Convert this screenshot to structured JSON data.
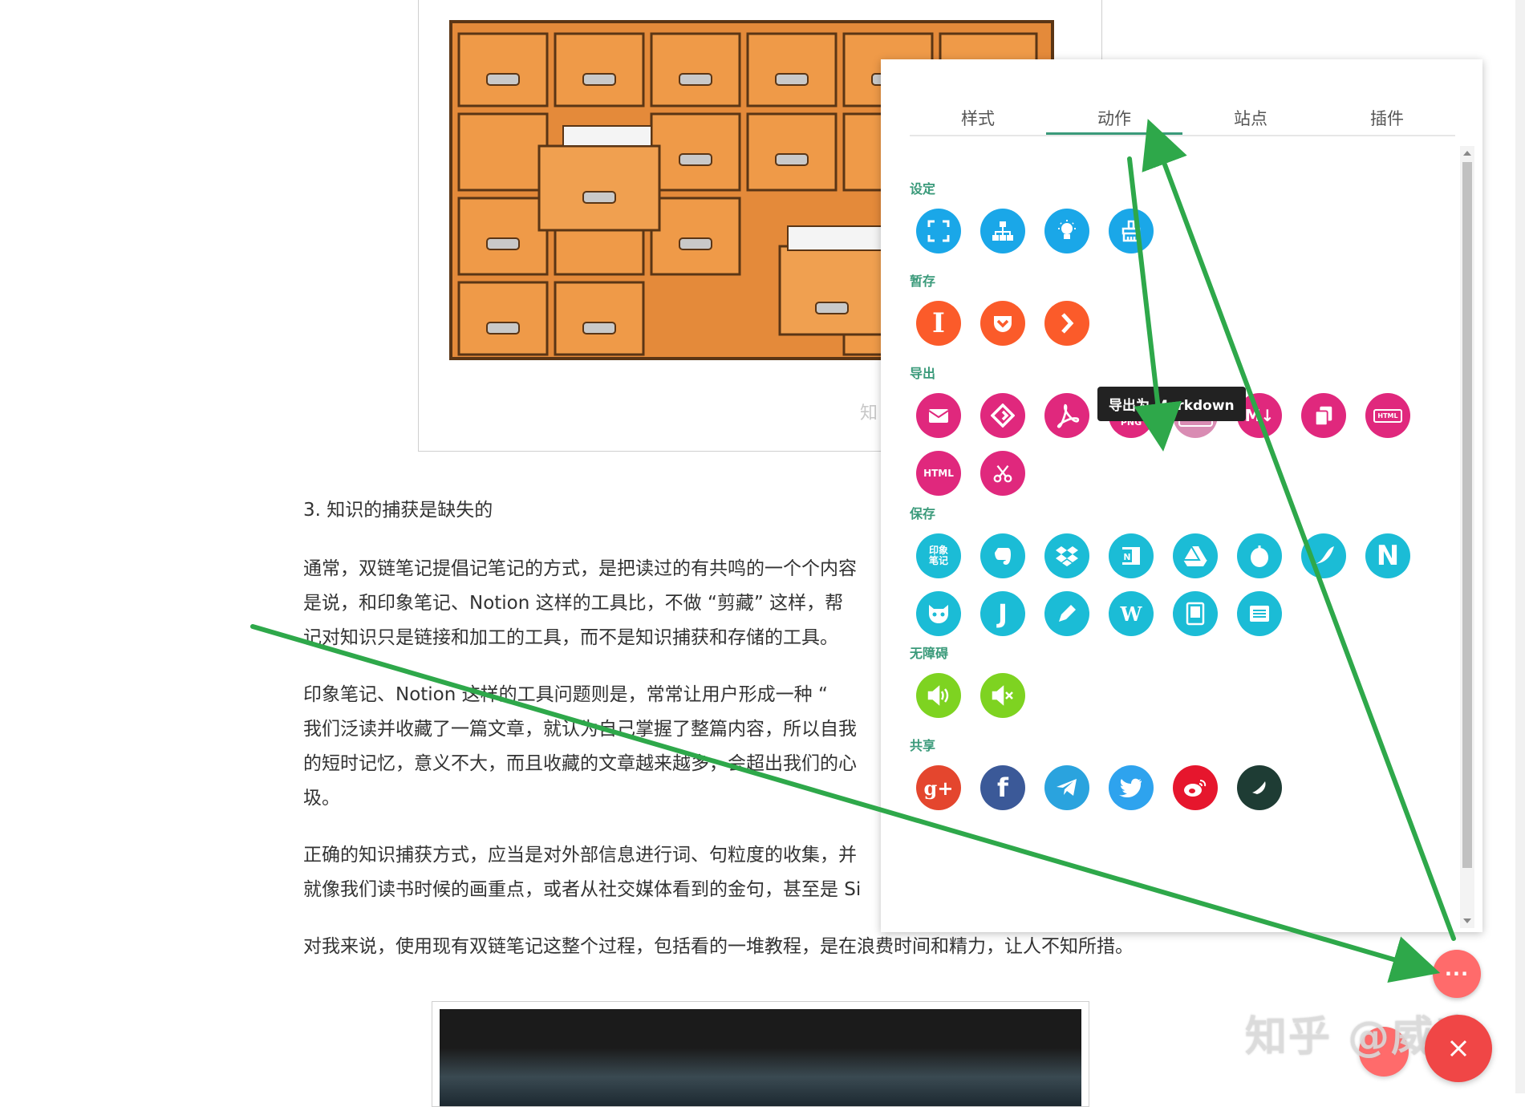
{
  "article": {
    "figure_watermark": "知",
    "heading": "3. 知识的捕获是缺失的",
    "paragraphs": [
      "通常，双链笔记提倡记笔记的方式，是把读过的有共鸣的一个个内容",
      "是说，和印象笔记、Notion 这样的工具比，不做 “剪藏” 这样，帮",
      "记对知识只是链接和加工的工具，而不是知识捕获和存储的工具。",
      "印象笔记、Notion 这样的工具问题则是，常常让用户形成一种 “",
      "我们泛读并收藏了一篇文章，就认为自己掌握了整篇内容，所以自我",
      "的短时记忆，意义不大，而且收藏的文章越来越多，会超出我们的心",
      "圾。",
      "正确的知识捕获方式，应当是对外部信息进行词、句粒度的收集，并",
      "就像我们读书时候的画重点，或者从社交媒体看到的金句，甚至是 Si",
      "对我来说，使用现有双链笔记这整个过程，包括看的一堆教程，是在浪费时间和精力，让人不知所措。"
    ]
  },
  "panel": {
    "tabs": [
      "样式",
      "动作",
      "站点",
      "插件"
    ],
    "active_tab": "动作",
    "accent_color": "#3a9a7a",
    "sections": {
      "settings": {
        "title": "设定",
        "icons": [
          "fullscreen-icon",
          "sitemap-icon",
          "lightbulb-icon",
          "brush-icon"
        ]
      },
      "stash": {
        "title": "暂存",
        "icons": [
          "instapaper-icon",
          "pocket-icon",
          "linnk-icon"
        ],
        "labels": {
          "instapaper": "I"
        }
      },
      "export": {
        "title": "导出",
        "icons": [
          "email-icon",
          "epub-icon",
          "pdf-icon",
          "png-icon",
          "markdown-icon",
          "markdown-alt-icon",
          "copy-icon",
          "html-icon",
          "html-offline-icon",
          "scissors-icon"
        ],
        "labels": {
          "png": "PNG",
          "markdown": "M↓",
          "markdown_alt": "M↓",
          "html_small": "HTML",
          "html": "HTML"
        }
      },
      "save": {
        "title": "保存",
        "icons": [
          "yinxiang-icon",
          "evernote-icon",
          "dropbox-icon",
          "onenote-icon",
          "google-drive-icon",
          "jianguoyun-icon",
          "yuque-icon",
          "notion-icon",
          "github-icon",
          "joplin-icon",
          "tinyflow-icon",
          "wolai-icon",
          "kindle-icon",
          "kindle-card-icon"
        ],
        "labels": {
          "yinxiang": "印象\n笔记",
          "notion": "N",
          "joplin": "J",
          "wolai": "W"
        }
      },
      "accessibility": {
        "title": "无障碍",
        "icons": [
          "speaker-on-icon",
          "speaker-mute-icon"
        ]
      },
      "share": {
        "title": "共享",
        "icons": [
          "google-plus-icon",
          "facebook-icon",
          "telegram-icon",
          "twitter-icon",
          "weibo-icon",
          "other-share-icon"
        ],
        "labels": {
          "gplus": "g+",
          "fb": "f"
        }
      }
    },
    "tooltip": "导出为 Markdown"
  },
  "fab": {
    "more_label": "···"
  },
  "watermark": "知乎 @威康"
}
